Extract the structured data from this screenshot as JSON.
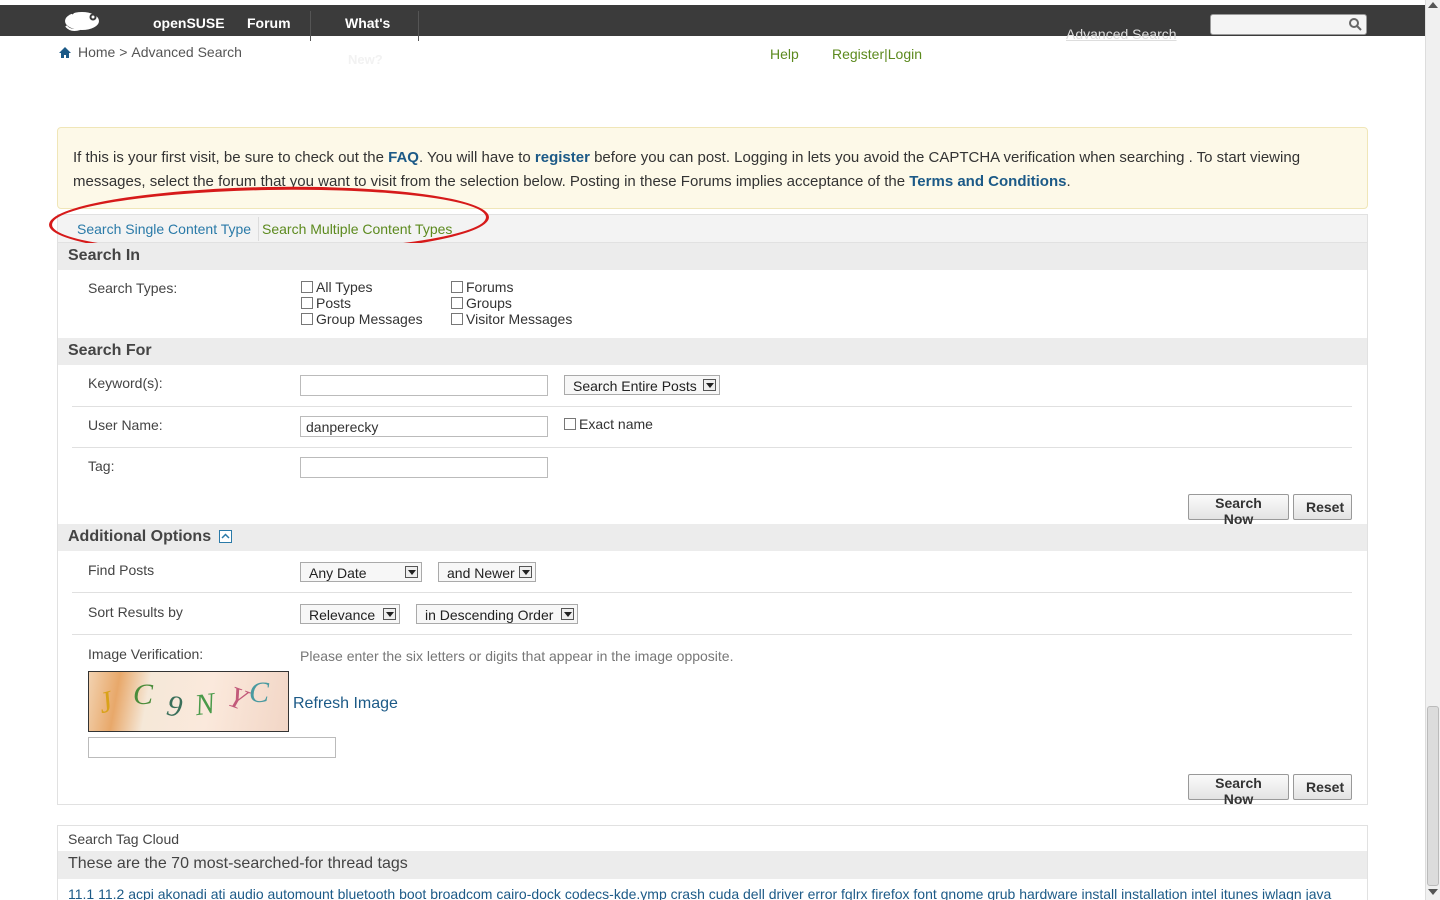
{
  "nav": {
    "brand": "openSUSE",
    "forum": "Forum",
    "whats": "What's",
    "whats2": "New?",
    "advanced_search": "Advanced Search",
    "search_placeholder": ""
  },
  "breadcrumb": {
    "home": "Home >",
    "current": "Advanced Search"
  },
  "links": {
    "help": "Help",
    "register_login": "Register|Login"
  },
  "notice": {
    "t1": "If this is your first visit, be sure to check out the ",
    "faq": "FAQ",
    "t2": ". You will have to ",
    "register": "register",
    "t3": " before you can post. Logging in lets you avoid the CAPTCHA verification when searching . To start viewing messages, select the forum that you want to visit from the selection below. Posting in these Forums implies acceptance of the ",
    "terms": "Terms and Conditions",
    "t4": "."
  },
  "tabs": {
    "single": "Search Single Content Type",
    "multiple": "Search Multiple Content Types"
  },
  "search_in": {
    "heading": "Search In",
    "label": "Search Types:",
    "types": [
      "All Types",
      "Posts",
      "Group Messages",
      "Forums",
      "Groups",
      "Visitor Messages"
    ]
  },
  "search_for": {
    "heading": "Search For",
    "keywords_label": "Keyword(s):",
    "keywords_value": "",
    "scope": "Search Entire Posts",
    "username_label": "User Name:",
    "username_value": "danperecky",
    "exact_name": "Exact name",
    "tag_label": "Tag:",
    "tag_value": ""
  },
  "buttons": {
    "search_now": "Search Now",
    "reset": "Reset"
  },
  "additional": {
    "heading": "Additional Options",
    "find_posts_label": "Find Posts",
    "date": "Any Date",
    "newer": "and Newer",
    "sort_label": "Sort Results by",
    "sort": "Relevance",
    "order": "in Descending Order",
    "verification_label": "Image Verification:",
    "verification_hint": "Please enter the six letters or digits that appear in the image opposite.",
    "refresh": "Refresh Image",
    "captcha_value": ""
  },
  "tag_cloud": {
    "title": "Search Tag Cloud",
    "subtitle": "These are the 70 most-searched-for thread tags",
    "tags": "11.1 11.2 acpi akonadi ati audio automount bluetooth boot broadcom cairo-dock codecs-kde.ymp crash cuda dell driver error fglrx firefox font gnome grub hardware install installation intel itunes iwlagn java"
  },
  "colors": {
    "topbar": "#3b3b3b",
    "link_blue": "#1c5a87",
    "link_green": "#5c8a1e",
    "annotation_red": "#d61a1a"
  }
}
